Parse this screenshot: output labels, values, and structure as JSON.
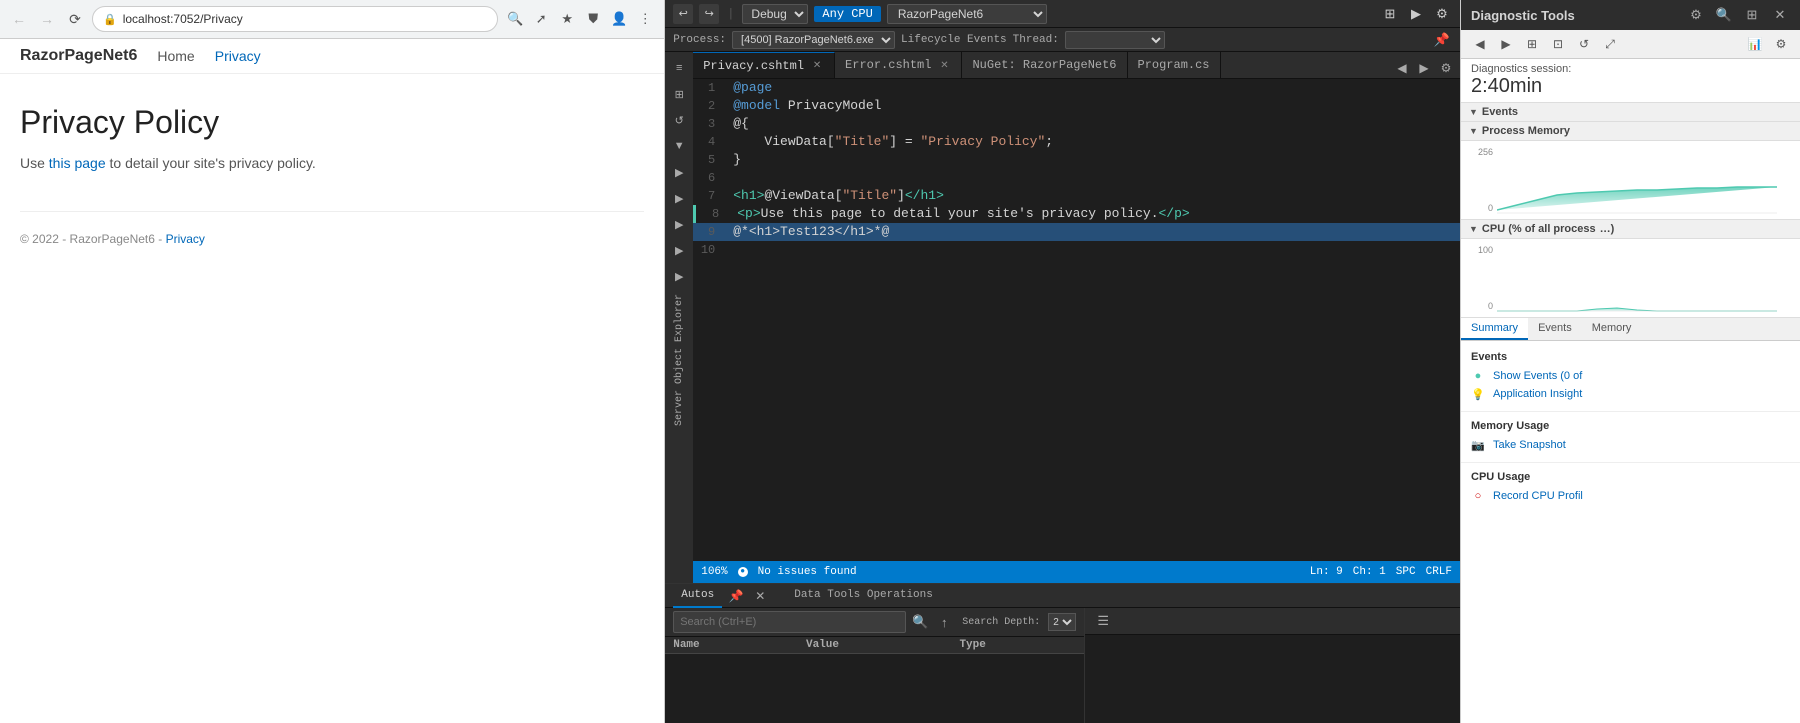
{
  "browser": {
    "url": "localhost:7052/Privacy",
    "back_disabled": true,
    "forward_disabled": true
  },
  "site": {
    "logo": "RazorPageNet6",
    "nav": [
      "Home",
      "Privacy"
    ],
    "active_nav": "Privacy"
  },
  "page": {
    "title": "Privacy Policy",
    "description_1": "Use ",
    "description_link": "this page",
    "description_2": " to detail your site's privacy policy.",
    "footer": "© 2022 - RazorPageNet6 - ",
    "footer_link": "Privacy"
  },
  "vscode": {
    "debug_mode": "Debug",
    "cpu_label": "Any CPU",
    "solution_name": "RazorPageNet6",
    "process": "[4500] RazorPageNet6.exe",
    "lifecycle": "Lifecycle Events",
    "thread_label": "Thread:",
    "thread_value": "",
    "tabs": [
      {
        "name": "Privacy.cshtml",
        "active": true,
        "has_close": true
      },
      {
        "name": "Error.cshtml",
        "active": false,
        "has_close": true
      },
      {
        "name": "NuGet: RazorPageNet6",
        "active": false,
        "has_close": false
      },
      {
        "name": "Program.cs",
        "active": false,
        "has_close": false
      }
    ],
    "code_lines": [
      {
        "num": 1,
        "tokens": [
          {
            "t": "kw",
            "v": "@page"
          }
        ]
      },
      {
        "num": 2,
        "tokens": [
          {
            "t": "kw",
            "v": "@model"
          },
          {
            "t": "plain",
            "v": " PrivacyModel"
          }
        ]
      },
      {
        "num": 3,
        "tokens": [
          {
            "t": "plain",
            "v": "@{"
          }
        ]
      },
      {
        "num": 4,
        "tokens": [
          {
            "t": "plain",
            "v": "    ViewData["
          },
          {
            "t": "str",
            "v": "\"Title\""
          },
          {
            "t": "plain",
            "v": "] = "
          },
          {
            "t": "str",
            "v": "\"Privacy Policy\""
          },
          {
            "t": "plain",
            "v": ";"
          }
        ]
      },
      {
        "num": 5,
        "tokens": [
          {
            "t": "plain",
            "v": "}"
          }
        ]
      },
      {
        "num": 6,
        "tokens": []
      },
      {
        "num": 7,
        "tokens": [
          {
            "t": "tag",
            "v": "<h1>"
          },
          {
            "t": "plain",
            "v": "@ViewData["
          },
          {
            "t": "str",
            "v": "\"Title\""
          },
          {
            "t": "plain",
            "v": "]"
          },
          {
            "t": "tag",
            "v": "</h1>"
          }
        ]
      },
      {
        "num": 8,
        "tokens": [
          {
            "t": "tag",
            "v": "<p>"
          },
          {
            "t": "plain",
            "v": "Use this page to detail your site's privacy policy."
          },
          {
            "t": "tag",
            "v": "</p>"
          }
        ],
        "border": "green"
      },
      {
        "num": 9,
        "tokens": [
          {
            "t": "plain",
            "v": "@*<h1>Test123</h1>*@"
          }
        ],
        "selected": true
      },
      {
        "num": 10,
        "tokens": []
      }
    ],
    "zoom": "106%",
    "status": "No issues found",
    "ln": "Ln: 9",
    "ch": "Ch: 1",
    "spc": "SPC",
    "crlf": "CRLF",
    "bottom_tabs": [
      {
        "name": "Autos",
        "active": true
      },
      {
        "name": "Data Tools Operations",
        "active": false
      }
    ],
    "autos_search_placeholder": "Search (Ctrl+E)",
    "autos_search_depth": "Search Depth:",
    "autos_columns": [
      "Name",
      "Value",
      "Type"
    ]
  },
  "diagnostic": {
    "title": "Diagnostic Tools",
    "session_label": "Diagnostics session:",
    "session_time": "2:40min",
    "events_section": "Events",
    "process_memory_section": "Process Memory",
    "cpu_section": "CPU (% of all process",
    "process_memory_max": "256",
    "process_memory_min": "0",
    "cpu_max": "100",
    "cpu_min": "0",
    "tabs": [
      "Summary",
      "Events",
      "Memory"
    ],
    "active_tab": "Summary",
    "summary": {
      "events_title": "Events",
      "show_events": "Show Events (0 of",
      "app_insight": "Application Insight",
      "memory_title": "Memory Usage",
      "take_snapshot": "Take Snapshot",
      "cpu_title": "CPU Usage",
      "record_cpu": "Record CPU Profil"
    }
  }
}
